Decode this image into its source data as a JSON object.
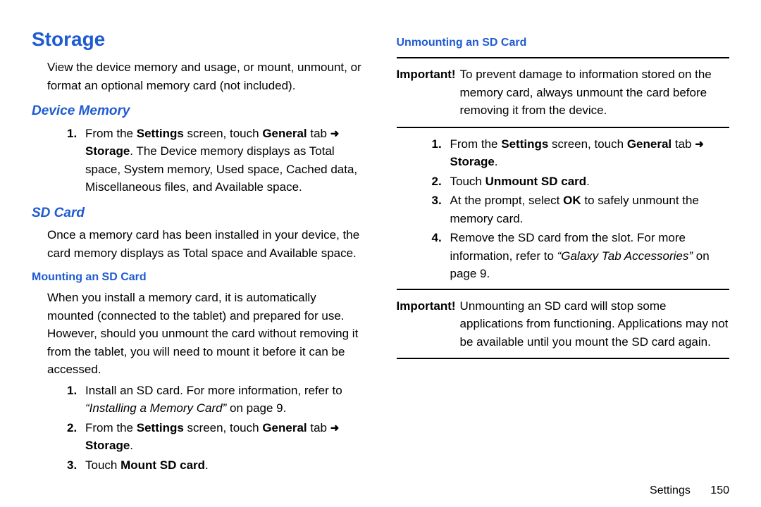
{
  "page_title": "Storage",
  "intro": "View the device memory and usage, or mount, unmount, or format an optional memory card (not included).",
  "device_memory": {
    "heading": "Device Memory",
    "step1_pre": "From the ",
    "step1_b1": "Settings",
    "step1_mid": " screen, touch ",
    "step1_b2": "General",
    "step1_tab": " tab ",
    "step1_b3": "Storage",
    "step1_post": ". The Device memory displays as Total space, System memory, Used space, Cached data, Miscellaneous files, and Available space."
  },
  "sd_card": {
    "heading": "SD Card",
    "para": "Once a memory card has been installed in your device, the card memory displays as Total space and Available space."
  },
  "mounting": {
    "heading": "Mounting an SD Card",
    "para": "When you install a memory card, it is automatically mounted (connected to the tablet) and prepared for use. However, should you unmount the card without removing it from the tablet, you will need to mount it before it can be accessed.",
    "step1_pre": "Install an SD card. For more information, refer to ",
    "step1_ref": "“Installing a Memory Card”",
    "step1_post": " on page 9.",
    "step2_pre": "From the ",
    "step2_b1": "Settings",
    "step2_mid": " screen, touch ",
    "step2_b2": "General",
    "step2_tab": " tab ",
    "step2_b3": "Storage",
    "step2_post": ".",
    "step3_pre": "Touch ",
    "step3_b": "Mount SD card",
    "step3_post": "."
  },
  "unmounting": {
    "heading": "Unmounting an SD Card",
    "important1_label": "Important!",
    "important1_text": "To prevent damage to information stored on the memory card, always unmount the card before removing it from the device.",
    "step1_pre": "From the ",
    "step1_b1": "Settings",
    "step1_mid": " screen, touch ",
    "step1_b2": "General",
    "step1_tab": " tab ",
    "step1_b3": "Storage",
    "step1_post": ".",
    "step2_pre": "Touch ",
    "step2_b": "Unmount SD card",
    "step2_post": ".",
    "step3_pre": "At the prompt, select ",
    "step3_b": "OK",
    "step3_post": " to safely unmount the memory card.",
    "step4_pre": "Remove the SD card from the slot. For more information, refer to ",
    "step4_ref": "“Galaxy Tab Accessories”",
    "step4_post": " on page 9.",
    "important2_label": "Important!",
    "important2_text": "Unmounting an SD card will stop some applications from functioning. Applications may not be available until you mount the SD card again."
  },
  "footer": {
    "section": "Settings",
    "page": "150"
  },
  "arrow": "➜"
}
